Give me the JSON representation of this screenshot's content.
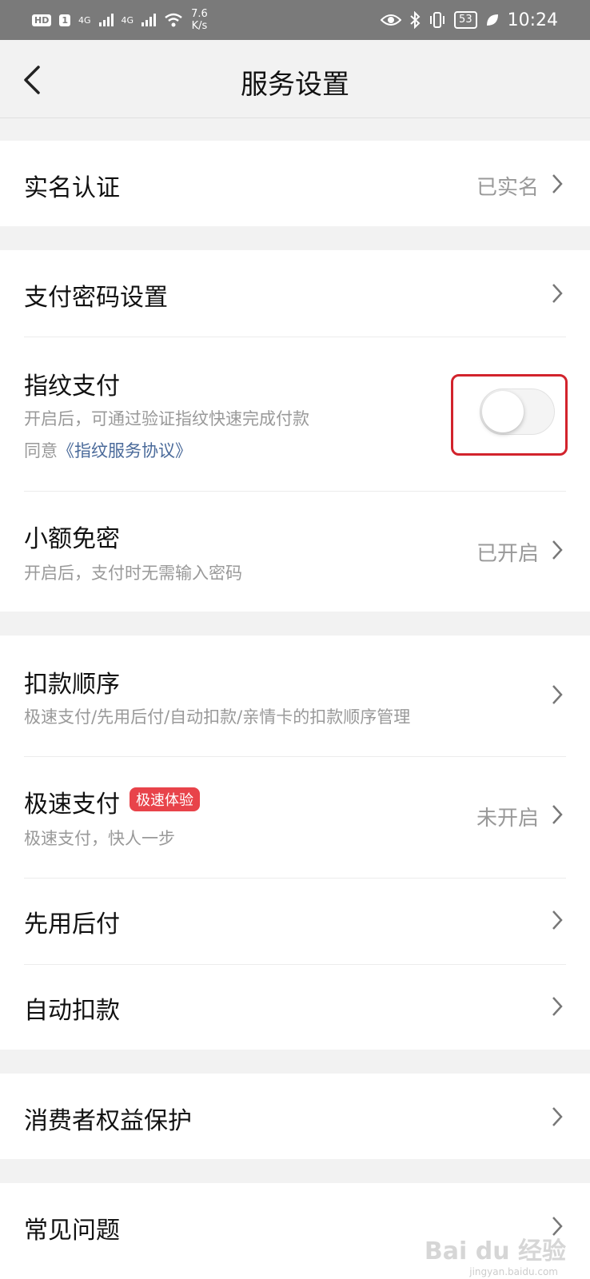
{
  "status_bar": {
    "hd": "HD",
    "sim1": "1",
    "net1": "4G",
    "net2": "4G",
    "speed_value": "7.6",
    "speed_unit": "K/s",
    "battery": "53",
    "time": "10:24"
  },
  "header": {
    "title": "服务设置"
  },
  "rows": {
    "real_name": {
      "title": "实名认证",
      "value": "已实名"
    },
    "pay_password": {
      "title": "支付密码设置"
    },
    "fingerprint": {
      "title": "指纹支付",
      "subtitle": "开启后，可通过验证指纹快速完成付款",
      "agree_prefix": "同意",
      "agree_link": "《指纹服务协议》",
      "enabled": false
    },
    "small_free": {
      "title": "小额免密",
      "subtitle": "开启后，支付时无需输入密码",
      "value": "已开启"
    },
    "deduct_order": {
      "title": "扣款顺序",
      "subtitle": "极速支付/先用后付/自动扣款/亲情卡的扣款顺序管理"
    },
    "fast_pay": {
      "title": "极速支付",
      "badge": "极速体验",
      "subtitle": "极速支付，快人一步",
      "value": "未开启"
    },
    "pay_later": {
      "title": "先用后付"
    },
    "auto_deduct": {
      "title": "自动扣款"
    },
    "consumer_rights": {
      "title": "消费者权益保护"
    },
    "faq": {
      "title": "常见问题"
    }
  },
  "watermark": {
    "text": "Bai du 经验",
    "sub": "jingyan.baidu.com"
  },
  "colors": {
    "status_bar": "#7a7a7a",
    "background": "#f2f2f2",
    "badge": "#e8434a",
    "link": "#4a6a9a",
    "highlight": "#d2232c"
  }
}
